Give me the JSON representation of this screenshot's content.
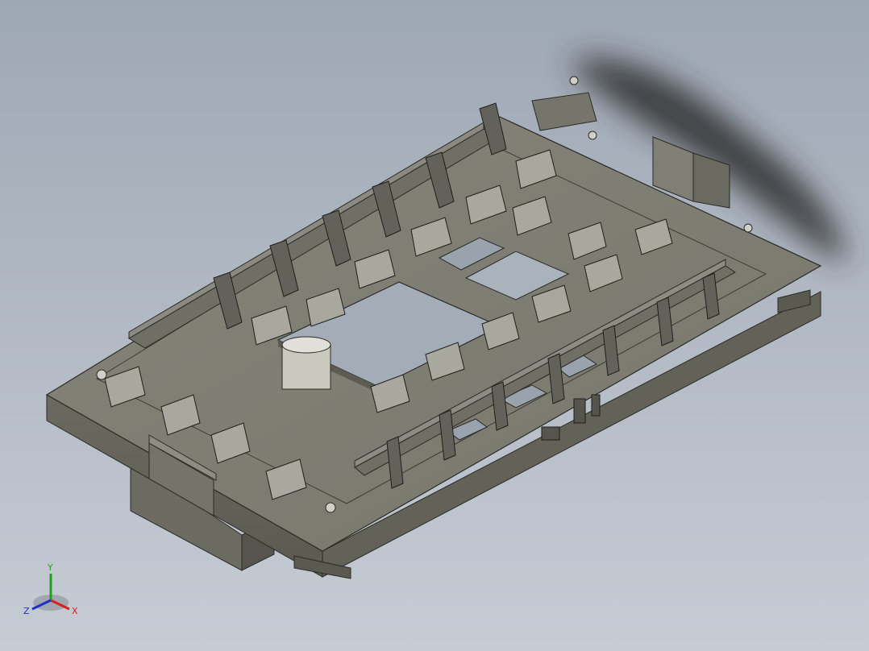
{
  "view": {
    "background_top": "#9ea7b4",
    "background_bottom": "#c6ccd4",
    "model_color": "#7d7d72",
    "model_edge_color": "#2b2b27",
    "shadow_color": "#3a3a3a"
  },
  "triad": {
    "x_label": "X",
    "y_label": "Y",
    "z_label": "Z",
    "x_color": "#d42020",
    "y_color": "#1fa01f",
    "z_color": "#2030c8"
  }
}
